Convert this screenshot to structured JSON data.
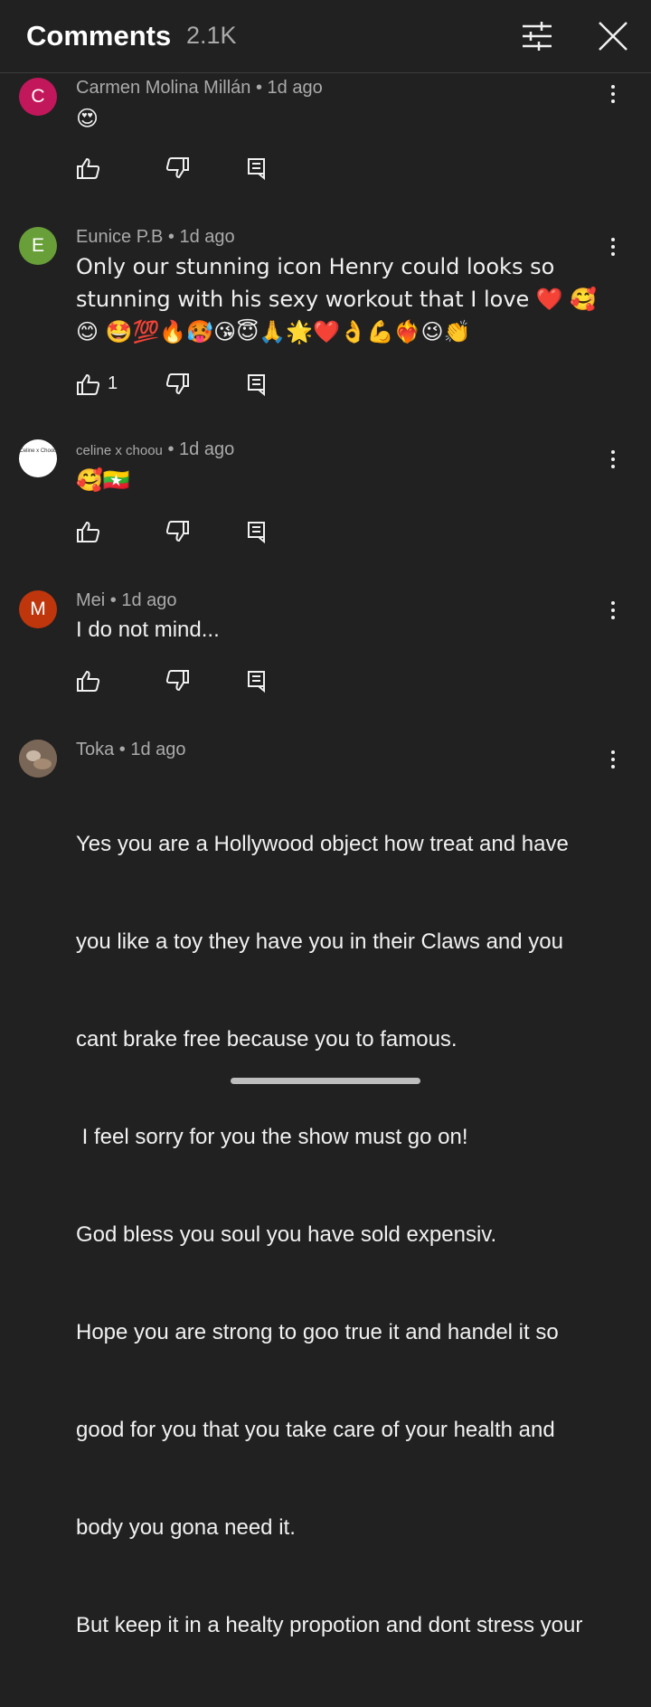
{
  "header": {
    "title": "Comments",
    "count": "2.1K"
  },
  "colors": {
    "background": "#212121",
    "avatar_c": "#c2185b",
    "avatar_e": "#689f38",
    "avatar_m": "#bf360c"
  },
  "comments": [
    {
      "avatar_letter": "C",
      "author": "Carmen Molina Millán",
      "time": "1d ago",
      "text": "😍",
      "likes": ""
    },
    {
      "avatar_letter": "E",
      "author": "Eunice P.B",
      "time": "1d ago",
      "text": "Only our stunning icon Henry could looks so stunning with his sexy workout that I love ❤️ 🥰😊 🤩💯🔥🥵😘😇🙏🌟❤️👌💪❤️‍🔥😉👏",
      "likes": "1"
    },
    {
      "avatar_letter": "",
      "avatar_text": "Celine x Choou",
      "author": "celine x choou",
      "time": "1d ago",
      "text": "🥰🇲🇲",
      "likes": ""
    },
    {
      "avatar_letter": "M",
      "author": "Mei",
      "time": "1d ago",
      "text": "I do not mind...",
      "likes": ""
    },
    {
      "avatar_letter": "",
      "author": "Toka",
      "time": "1d ago",
      "text_lines": [
        "Yes you are a Hollywood object how treat and have",
        "you like a toy they have you in their Claws and you",
        "cant brake free because you to famous.",
        " I feel sorry for you the show must go on!",
        "God bless you soul you have sold expensiv.",
        "Hope you are strong to goo true it and handel it so",
        "good for you that you take care of your health and",
        "body you gona need it.",
        "But keep it in a healty propotion and dont stress your"
      ],
      "likes": ""
    }
  ]
}
